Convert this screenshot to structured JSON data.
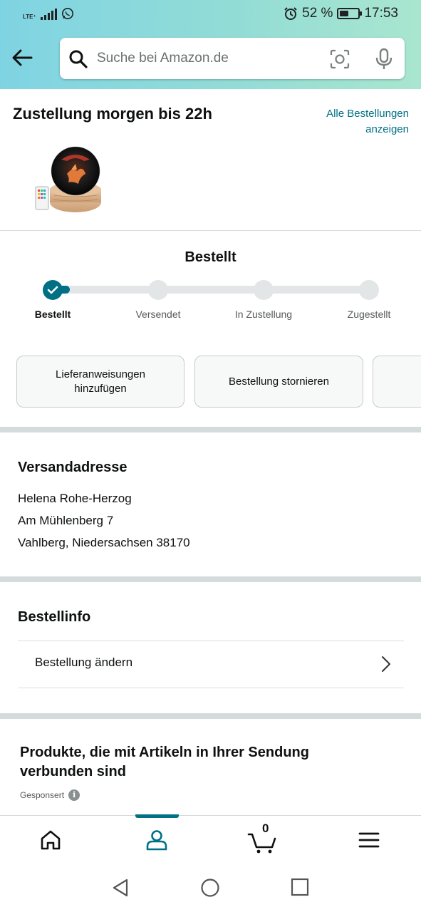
{
  "status_bar": {
    "network": "LTE⁺",
    "battery_text": "52 %",
    "battery_level": 0.52,
    "time": "17:53"
  },
  "search": {
    "placeholder": "Suche bei Amazon.de"
  },
  "delivery": {
    "title": "Zustellung morgen bis 22h",
    "all_orders_link": "Alle Bestellungen anzeigen"
  },
  "progress": {
    "title": "Bestellt",
    "steps": [
      {
        "label": "Bestellt",
        "done": true
      },
      {
        "label": "Versendet",
        "done": false
      },
      {
        "label": "In Zustellung",
        "done": false
      },
      {
        "label": "Zugestellt",
        "done": false
      }
    ]
  },
  "actions": [
    {
      "label": "Lieferanweisungen hinzufügen"
    },
    {
      "label": "Bestellung stornieren"
    }
  ],
  "shipping": {
    "title": "Versandadresse",
    "lines": [
      "Helena Rohe-Herzog",
      "Am Mühlenberg 7",
      "Vahlberg, Niedersachsen 38170"
    ]
  },
  "order_info": {
    "title": "Bestellinfo",
    "change_order": "Bestellung ändern"
  },
  "related": {
    "title": "Produkte, die mit Artikeln in Ihrer Sendung verbunden sind",
    "sponsored": "Gesponsert"
  },
  "bottom_nav": {
    "cart_count": "0",
    "items": [
      "home-icon",
      "account-icon",
      "cart-icon",
      "menu-icon"
    ]
  },
  "colors": {
    "accent": "#007185",
    "header_gradient_start": "#7fd4e3",
    "header_gradient_end": "#a9e6cf"
  }
}
